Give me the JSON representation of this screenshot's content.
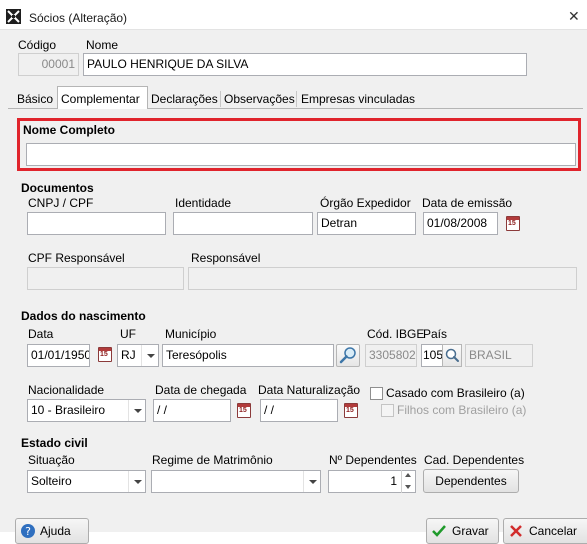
{
  "window": {
    "title": "Sócios (Alteração)",
    "close": "✕"
  },
  "header": {
    "codigo_label": "Código",
    "codigo_value": "00001",
    "nome_label": "Nome",
    "nome_value": "PAULO HENRIQUE DA SILVA"
  },
  "tabs": [
    {
      "label": "Básico",
      "active": false
    },
    {
      "label": "Complementar",
      "active": true
    },
    {
      "label": "Declarações",
      "active": false
    },
    {
      "label": "Observações",
      "active": false
    },
    {
      "label": "Empresas vinculadas",
      "active": false
    }
  ],
  "nome_completo": {
    "label": "Nome Completo",
    "value": ""
  },
  "documentos": {
    "title": "Documentos",
    "cnpj_cpf_label": "CNPJ / CPF",
    "cnpj_cpf_value": "",
    "identidade_label": "Identidade",
    "identidade_value": "",
    "orgao_label": "Órgão Expedidor",
    "orgao_value": "Detran",
    "emissao_label": "Data de emissão",
    "emissao_value": "01/08/2008",
    "cpf_resp_label": "CPF Responsável",
    "cpf_resp_value": "",
    "responsavel_label": "Responsável",
    "responsavel_value": ""
  },
  "nascimento": {
    "title": "Dados do nascimento",
    "data_label": "Data",
    "data_value": "01/01/1950",
    "uf_label": "UF",
    "uf_value": "RJ",
    "municipio_label": "Município",
    "municipio_value": "Teresópolis",
    "ibge_label": "Cód. IBGE",
    "ibge_value": "3305802",
    "pais_label": "País",
    "pais_code": "105",
    "pais_name": "BRASIL",
    "nacionalidade_label": "Nacionalidade",
    "nacionalidade_value": "10 - Brasileiro",
    "chegada_label": "Data de chegada",
    "chegada_value": " /  /",
    "naturalizacao_label": "Data Naturalização",
    "naturalizacao_value": " /  /",
    "casado_label": "Casado com Brasileiro (a)",
    "filhos_label": "Filhos com Brasileiro (a)"
  },
  "estado_civil": {
    "title": "Estado civil",
    "situacao_label": "Situação",
    "situacao_value": "Solteiro",
    "regime_label": "Regime de Matrimônio",
    "regime_value": "",
    "dependentes_label": "Nº Dependentes",
    "dependentes_value": "1",
    "cad_dep_label": "Cad. Dependentes",
    "dependentes_button": "Dependentes"
  },
  "footer": {
    "ajuda": "Ajuda",
    "gravar": "Gravar",
    "cancelar": "Cancelar"
  },
  "calendar_icon_text": "15",
  "colors": {
    "highlight": "#e0242c",
    "background": "#f0f0f0"
  }
}
